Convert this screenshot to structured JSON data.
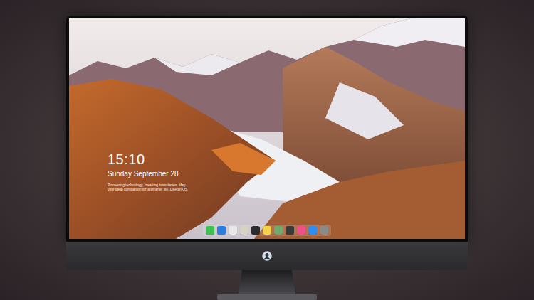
{
  "desktop": {
    "clock": {
      "time": "15:10",
      "date": "Sunday September 28"
    },
    "tagline": [
      "Pioneering technology, breaking boundaries. May",
      "your ideal companion for a smarter life. Deepin OS"
    ]
  },
  "dock": {
    "apps": [
      {
        "color": "#3ec14f"
      },
      {
        "color": "#2b7de0"
      },
      {
        "color": "#e8e8e8"
      },
      {
        "color": "#d6d2c4"
      },
      {
        "color": "#2b2b2b"
      },
      {
        "color": "#f5d24a"
      },
      {
        "color": "#6ea86b"
      },
      {
        "color": "#3a3a3a"
      },
      {
        "color": "#f24f8a"
      },
      {
        "color": "#2f8cf2"
      },
      {
        "color": "#8a8a8a"
      }
    ]
  }
}
